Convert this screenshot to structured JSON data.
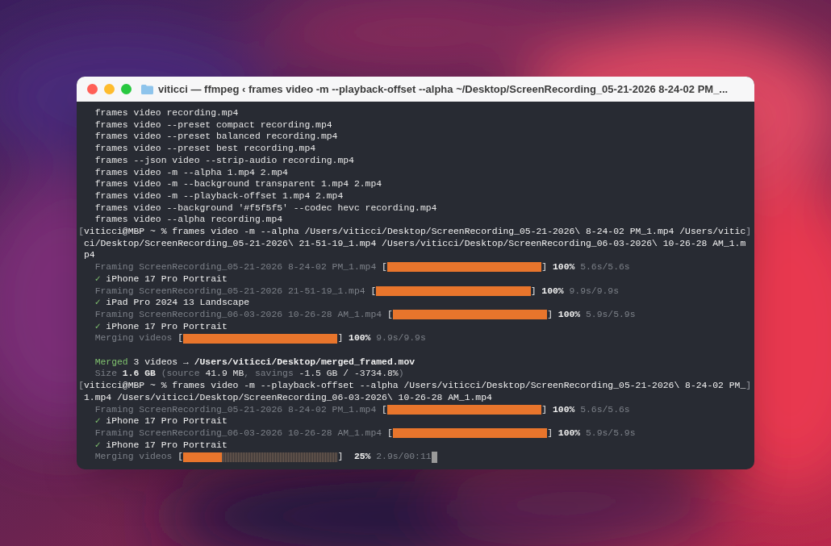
{
  "window": {
    "title": "viticci — ffmpeg ‹ frames video -m --playback-offset --alpha ~/Desktop/ScreenRecording_05-21-2026 8-24-02 PM_..."
  },
  "lines": [
    {
      "kind": "plain",
      "text": "frames video recording.mp4"
    },
    {
      "kind": "plain",
      "text": "frames video --preset compact recording.mp4"
    },
    {
      "kind": "plain",
      "text": "frames video --preset balanced recording.mp4"
    },
    {
      "kind": "plain",
      "text": "frames video --preset best recording.mp4"
    },
    {
      "kind": "plain",
      "text": "frames --json video --strip-audio recording.mp4"
    },
    {
      "kind": "plain",
      "text": "frames video -m --alpha 1.mp4 2.mp4"
    },
    {
      "kind": "plain",
      "text": "frames video -m --background transparent 1.mp4 2.mp4"
    },
    {
      "kind": "plain",
      "text": "frames video -m --playback-offset 1.mp4 2.mp4"
    },
    {
      "kind": "plain",
      "text": "frames video --background '#f5f5f5' --codec hevc recording.mp4"
    },
    {
      "kind": "plain",
      "text": "frames video --alpha recording.mp4"
    },
    {
      "kind": "prompt",
      "mark": "[",
      "end_mark": "]",
      "text": "viticci@MBP ~ % frames video -m --alpha /Users/viticci/Desktop/ScreenRecording_05-21-2026\\ 8-24-02 PM_1.mp4 /Users/viticci/Desktop/ScreenRecording_05-21-2026\\ 21-51-19_1.mp4 /Users/viticci/Desktop/ScreenRecording_06-03-2026\\ 10-26-28 AM_1.mp4"
    },
    {
      "kind": "progress",
      "label": "Framing ScreenRecording_05-21-2026 8-24-02 PM_1.mp4",
      "open": "[",
      "close": "]",
      "level": 1,
      "percent": "100%",
      "timing": "5.6s/5.6s"
    },
    {
      "kind": "success",
      "check": "✓",
      "text": "iPhone 17 Pro Portrait"
    },
    {
      "kind": "progress",
      "label": "Framing ScreenRecording_05-21-2026 21-51-19_1.mp4",
      "open": "[",
      "close": "]",
      "level": 1,
      "percent": "100%",
      "timing": "9.9s/9.9s"
    },
    {
      "kind": "success",
      "check": "✓",
      "text": "iPad Pro 2024 13 Landscape"
    },
    {
      "kind": "progress",
      "label": "Framing ScreenRecording_06-03-2026 10-26-28 AM_1.mp4",
      "open": "[",
      "close": "]",
      "level": 1,
      "percent": "100%",
      "timing": "5.9s/5.9s"
    },
    {
      "kind": "success",
      "check": "✓",
      "text": "iPhone 17 Pro Portrait"
    },
    {
      "kind": "progress",
      "label": "Merging videos",
      "open": "[",
      "close": "]",
      "level": 1,
      "percent": "100%",
      "timing": "9.9s/9.9s"
    },
    {
      "kind": "blank"
    },
    {
      "kind": "merged",
      "label": "Merged",
      "text": "3 videos → **/Users/viticci/Desktop/merged_framed.mov**"
    },
    {
      "kind": "summary",
      "segments": [
        {
          "dim": true,
          "bold": false,
          "text": "Size "
        },
        {
          "dim": false,
          "bold": true,
          "text": "1.6 GB"
        },
        {
          "dim": true,
          "bold": false,
          "text": " (source "
        },
        {
          "dim": false,
          "bold": false,
          "text": "41.9 MB"
        },
        {
          "dim": true,
          "bold": false,
          "text": ", savings "
        },
        {
          "dim": false,
          "bold": false,
          "text": "-1.5 GB / -3734.8%"
        },
        {
          "dim": true,
          "bold": false,
          "text": ")"
        }
      ]
    },
    {
      "kind": "prompt",
      "mark": "[",
      "end_mark": "]",
      "text": "viticci@MBP ~ % frames video -m --playback-offset --alpha /Users/viticci/Desktop/ScreenRecording_05-21-2026\\ 8-24-02 PM_1.mp4 /Users/viticci/Desktop/ScreenRecording_06-03-2026\\ 10-26-28 AM_1.mp4"
    },
    {
      "kind": "progress",
      "label": "Framing ScreenRecording_05-21-2026 8-24-02 PM_1.mp4",
      "open": "[",
      "close": "]",
      "level": 1,
      "percent": "100%",
      "timing": "5.6s/5.6s"
    },
    {
      "kind": "success",
      "check": "✓",
      "text": "iPhone 17 Pro Portrait"
    },
    {
      "kind": "progress",
      "label": "Framing ScreenRecording_06-03-2026 10-26-28 AM_1.mp4",
      "open": "[",
      "close": "]",
      "level": 1,
      "percent": "100%",
      "timing": "5.9s/5.9s"
    },
    {
      "kind": "success",
      "check": "✓",
      "text": "iPhone 17 Pro Portrait"
    },
    {
      "kind": "progress",
      "label": "Merging videos",
      "open": "[",
      "close": "]",
      "level": 0.25,
      "percent": "25%",
      "timing": "2.9s/00:11",
      "cursor": true
    }
  ]
}
